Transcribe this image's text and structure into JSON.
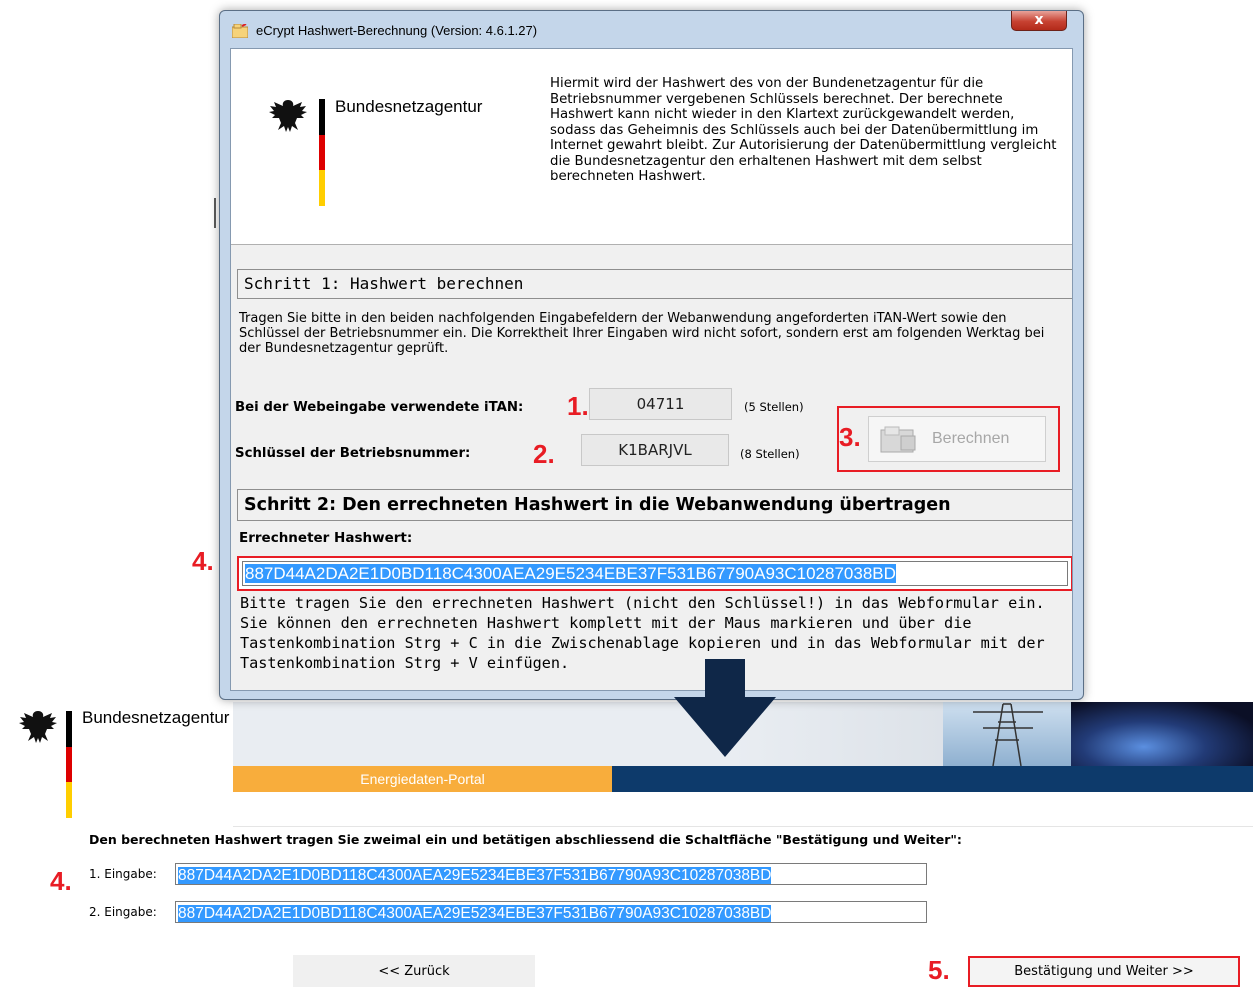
{
  "dialog": {
    "title": "eCrypt Hashwert-Berechnung (Version: 4.6.1.27)",
    "close_label": "x",
    "org_name": "Bundesnetzagentur",
    "description": "Hiermit wird der Hashwert des von der Bundenetzagentur für die Betriebsnummer vergebenen Schlüssels berechnet. Der berechnete Hashwert kann nicht wieder in den Klartext zurückgewandelt werden, sodass das Geheimnis des Schlüssels auch bei der Datenübermittlung im Internet gewahrt bleibt. Zur Autorisierung der Datenübermittlung vergleicht die Bundesnetzagentur den erhaltenen Hashwert mit dem selbst berechneten Hashwert.",
    "step1": {
      "title": "Schritt 1: Hashwert berechnen",
      "text": "Tragen Sie bitte in den beiden nachfolgenden Eingabefeldern der Webanwendung angeforderten iTAN-Wert sowie den Schlüssel der Betriebsnummer ein. Die Korrektheit Ihrer Eingaben wird nicht sofort, sondern erst am folgenden Werktag bei der Bundesnetzagentur geprüft.",
      "itan_label": "Bei der Webeingabe verwendete iTAN:",
      "itan_value": "04711",
      "itan_hint": "(5 Stellen)",
      "key_label": "Schlüssel der Betriebsnummer:",
      "key_value": "K1BARJVL",
      "key_hint": "(8 Stellen)",
      "calc_button": "Berechnen"
    },
    "step2": {
      "title": "Schritt 2: Den errechneten Hashwert in die Webanwendung übertragen",
      "hash_label": "Errechneter Hashwert:",
      "hash_value": "887D44A2DA2E1D0BD118C4300AEA29E5234EBE37F531B67790A93C10287038BD",
      "text": "Bitte tragen Sie den errechneten Hashwert (nicht den Schlüssel!) in das Webformular ein. Sie können den errechneten Hashwert komplett mit der Maus markieren und über die Tastenkombination Strg + C in die Zwischenablage kopieren und in das Webformular mit der Tastenkombination Strg + V einfügen."
    }
  },
  "annotations": {
    "step1": "1.",
    "step2": "2.",
    "step3": "3.",
    "step4": "4.",
    "step5": "5."
  },
  "portal": {
    "org_name": "Bundesnetzagentur",
    "nav_label": "Energiedaten-Portal",
    "instruction": "Den berechneten Hashwert tragen Sie zweimal ein und betätigen abschliessend die Schaltfläche \"Bestätigung und Weiter\":",
    "entry1_label": "1. Eingabe:",
    "entry1_value": "887D44A2DA2E1D0BD118C4300AEA29E5234EBE37F531B67790A93C10287038BD",
    "entry2_label": "2. Eingabe:",
    "entry2_value": "887D44A2DA2E1D0BD118C4300AEA29E5234EBE37F531B67790A93C10287038BD",
    "back_button": "<< Zurück",
    "next_button": "Bestätigung und Weiter >>"
  },
  "colors": {
    "annotation_red": "#e81c24",
    "selection_blue": "#3399ff",
    "portal_orange": "#f8ad3c",
    "portal_navy": "#0d3a6b",
    "arrow_navy": "#0f2748"
  },
  "icons": [
    "eagle-icon",
    "app-icon",
    "calculator-icon",
    "down-arrow-icon",
    "close-icon"
  ]
}
